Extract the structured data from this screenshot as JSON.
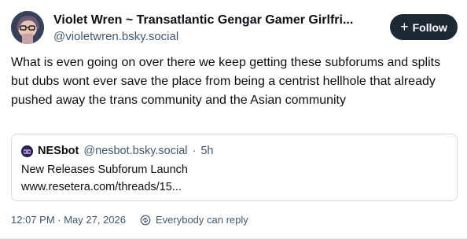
{
  "author": {
    "display_name": "Violet Wren ~ Transatlantic Gengar Gamer Girlfri...",
    "handle": "@violetwren.bsky.social"
  },
  "follow_button": {
    "icon": "+",
    "label": "Follow"
  },
  "post": {
    "text": "What is even going on over there we keep getting these subforums and splits but dubs wont ever save the place from being a centrist hellhole that already pushed away the trans community and the Asian community"
  },
  "quote": {
    "author": "NESbot",
    "handle": "@nesbot.bsky.social",
    "separator": "·",
    "age": "5h",
    "line1": "New Releases Subforum Launch",
    "line2": "www.resetera.com/threads/15..."
  },
  "footer": {
    "timestamp": "12:07 PM · May 27, 2026",
    "reply_setting": "Everybody can reply"
  },
  "colors": {
    "follow_bg": "#1e2936",
    "secondary_text": "#42576c",
    "border": "#d4dbe2"
  },
  "icons": {
    "avatar": "user-avatar",
    "quote_avatar": "nesbot-avatar",
    "follow": "plus-icon",
    "reply": "reply-settings-icon"
  }
}
